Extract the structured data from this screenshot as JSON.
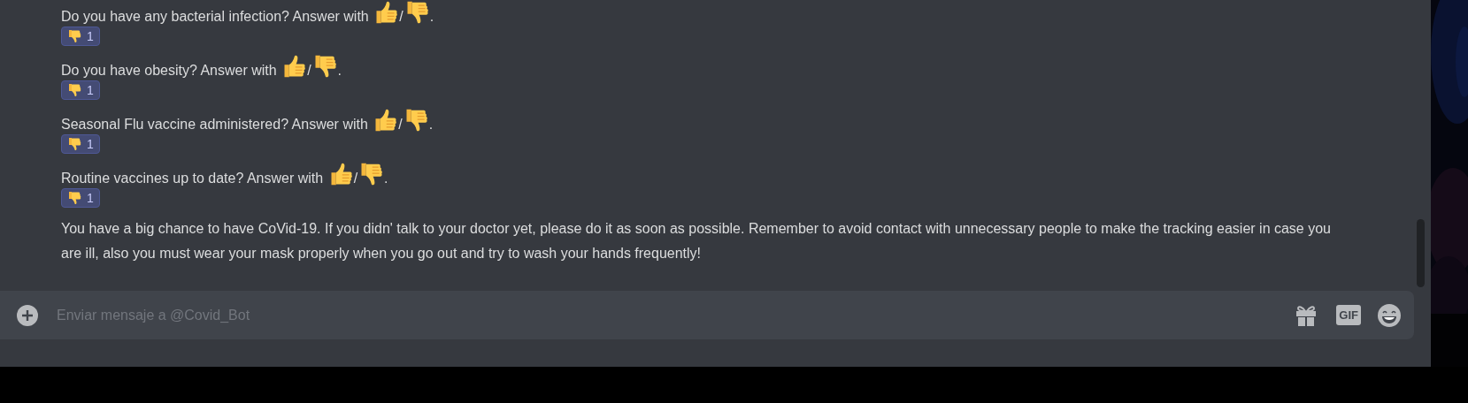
{
  "messages": [
    {
      "kind": "question",
      "text": "Do you have any bacterial infection? Answer with",
      "separator": "/",
      "end": ".",
      "reaction": {
        "count": "1",
        "selected": true
      }
    },
    {
      "kind": "question",
      "text": "Do you have obesity? Answer with",
      "separator": "/",
      "end": ".",
      "reaction": {
        "count": "1",
        "selected": true
      }
    },
    {
      "kind": "question",
      "text": "Seasonal Flu vaccine administered? Answer with",
      "separator": "/",
      "end": ".",
      "reaction": {
        "count": "1",
        "selected": true
      }
    },
    {
      "kind": "question",
      "text": "Routine vaccines up to date? Answer with",
      "separator": "/",
      "end": ".",
      "reaction": {
        "count": "1",
        "selected": true
      }
    },
    {
      "kind": "text",
      "text": "You have a big chance to have CoVid-19. If you didn' talk to your doctor yet, please do it as soon as possible. Remember to avoid contact with unnecessary people to make the tracking easier in case you are ill, also you must wear your mask properly when you go out and try to wash your hands frequently!"
    }
  ],
  "composer": {
    "placeholder": "Enviar mensaje a @Covid_Bot",
    "gif_label": "GIF"
  }
}
